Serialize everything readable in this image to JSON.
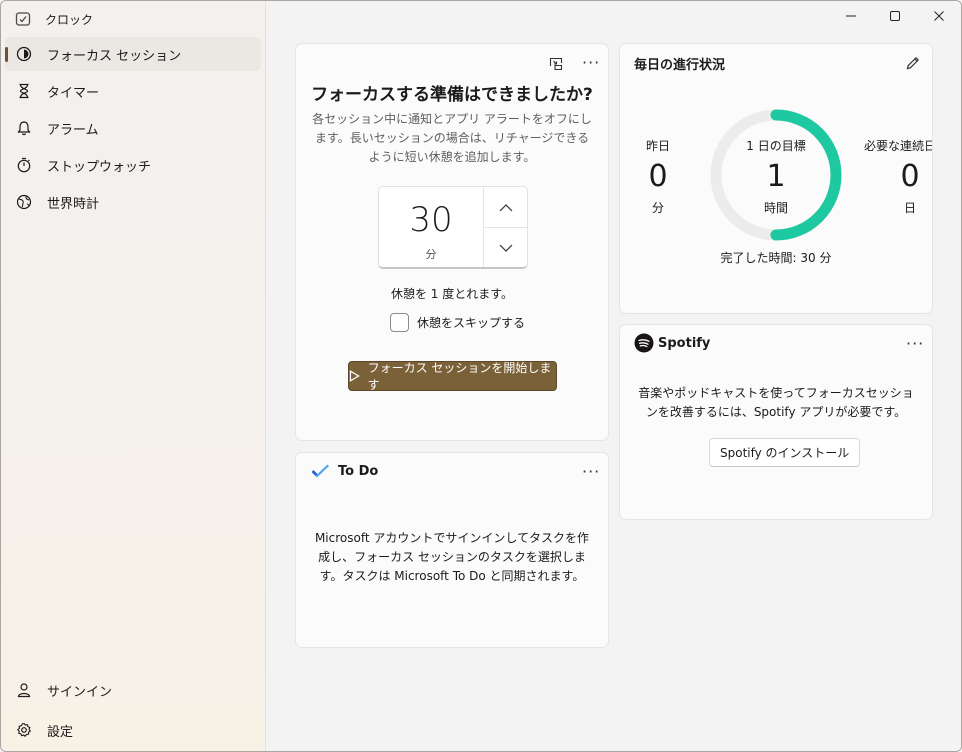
{
  "app": {
    "title": "クロック"
  },
  "sidebar": {
    "items": [
      {
        "label": "フォーカス セッション",
        "icon": "focus-icon",
        "active": true
      },
      {
        "label": "タイマー",
        "icon": "hourglass-icon"
      },
      {
        "label": "アラーム",
        "icon": "bell-icon"
      },
      {
        "label": "ストップウォッチ",
        "icon": "stopwatch-icon"
      },
      {
        "label": "世界時計",
        "icon": "globe-icon"
      }
    ],
    "bottom": [
      {
        "label": "サインイン",
        "icon": "person-icon"
      },
      {
        "label": "設定",
        "icon": "gear-icon"
      }
    ]
  },
  "focus": {
    "title": "フォーカスする準備はできましたか?",
    "description": "各セッション中に通知とアプリ アラートをオフにします。長いセッションの場合は、リチャージできるように短い休憩を追加します。",
    "minutes": "30",
    "unit": "分",
    "break_text": "休憩を 1 度とれます。",
    "skip_label": "休憩をスキップする",
    "start_label": "フォーカス セッションを開始します"
  },
  "todo": {
    "title": "To Do",
    "description": "Microsoft アカウントでサインインしてタスクを作成し、フォーカス セッションのタスクを選択します。タスクは Microsoft To Do と同期されます。"
  },
  "progress": {
    "title": "毎日の進行状況",
    "yesterday_label": "昨日",
    "yesterday_value": "0",
    "yesterday_unit": "分",
    "goal_label": "1 日の目標",
    "goal_value": "1",
    "goal_unit": "時間",
    "streak_label": "必要な連続日数",
    "streak_value": "0",
    "streak_unit": "日",
    "completed_text": "完了した時間: 30 分",
    "goal_progress_fraction": 0.5,
    "accent_color": "#1ec8a0"
  },
  "spotify": {
    "title": "Spotify",
    "description": "音楽やポッドキャストを使ってフォーカスセッションを改善するには、Spotify アプリが必要です。",
    "install_label": "Spotify のインストール"
  },
  "more_label": "···"
}
